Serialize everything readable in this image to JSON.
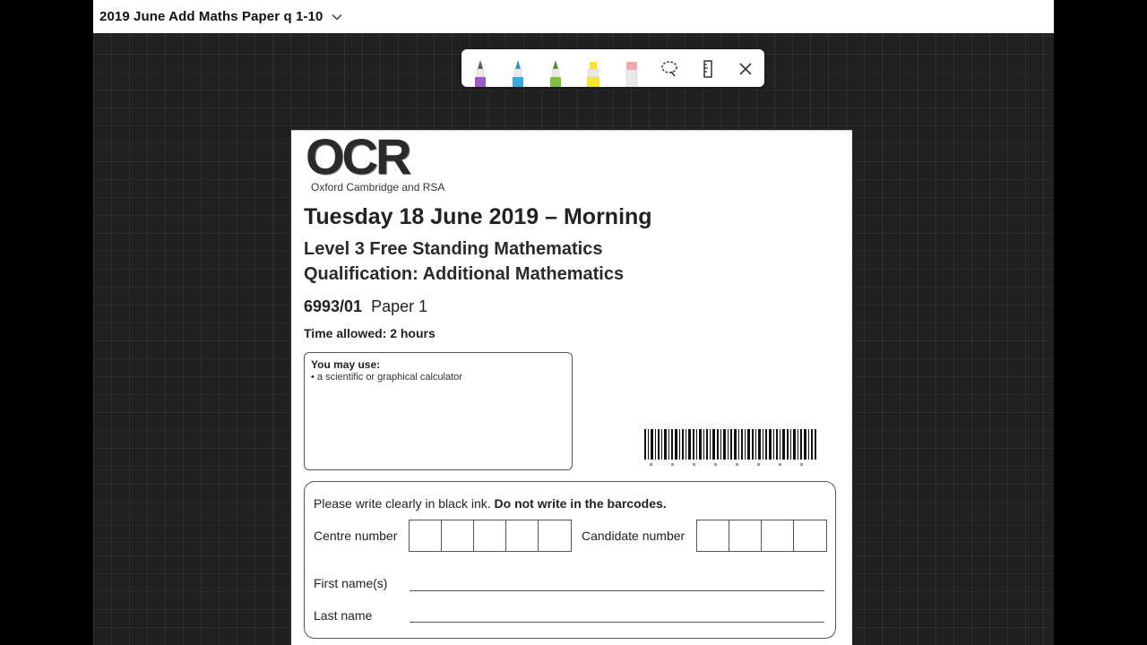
{
  "window": {
    "title": "2019 June Add Maths Paper q 1-10"
  },
  "toolbar": {
    "pens": [
      {
        "name": "purple-pen",
        "color": "#9b59c6"
      },
      {
        "name": "blue-pen",
        "color": "#3aa9df"
      },
      {
        "name": "green-pen",
        "color": "#7cc23d"
      },
      {
        "name": "yellow-highlighter",
        "color": "#f5e62a"
      },
      {
        "name": "pink-eraser",
        "color": "#f2a7ae"
      }
    ],
    "tools": [
      "lasso-select-icon",
      "ruler-icon",
      "close-icon"
    ]
  },
  "document": {
    "logo": "OCR",
    "logo_subtitle": "Oxford Cambridge and RSA",
    "date_line": "Tuesday 18 June 2019 – Morning",
    "level_line": "Level 3 Free Standing Mathematics",
    "qualification_line": "Qualification: Additional Mathematics",
    "paper_code": "6993/01",
    "paper_name": "Paper 1",
    "time_allowed": "Time allowed: 2 hours",
    "may_use": {
      "heading": "You may use:",
      "items": [
        "• a scientific or graphical calculator"
      ]
    },
    "candidate_form": {
      "instruction_plain": "Please write clearly in black ink. ",
      "instruction_bold": "Do not write in the barcodes.",
      "centre_number_label": "Centre number",
      "candidate_number_label": "Candidate number",
      "first_name_label": "First name(s)",
      "last_name_label": "Last name"
    }
  }
}
